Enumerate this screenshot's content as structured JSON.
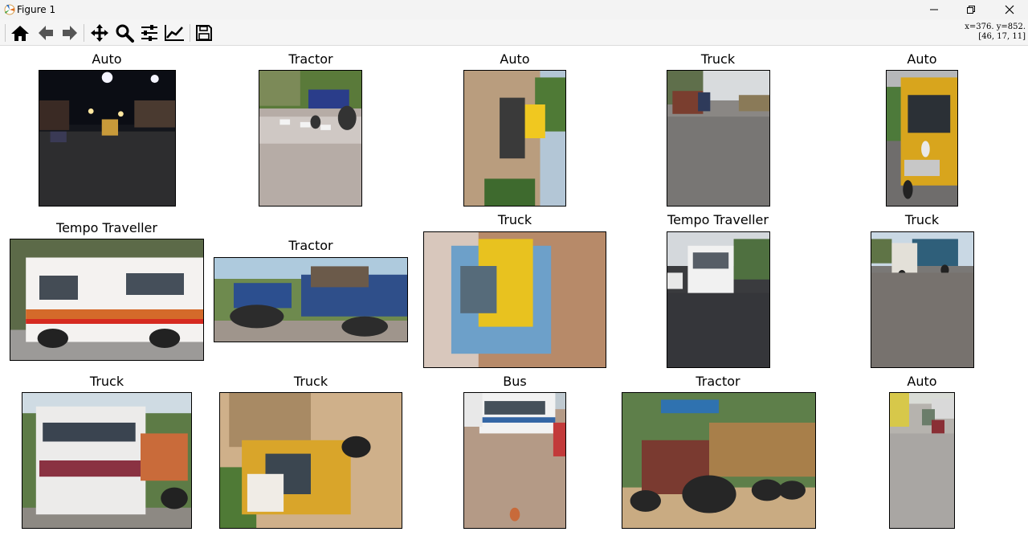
{
  "window": {
    "title": "Figure 1"
  },
  "toolbar": {
    "tools": [
      "home-icon",
      "back-icon",
      "forward-icon",
      "pan-icon",
      "zoom-icon",
      "configure-subplots-icon",
      "edit-axes-icon",
      "save-icon"
    ],
    "coords_line1": "x=376. y=852.",
    "coords_line2": "[46, 17, 11]"
  },
  "grid": {
    "row1": [
      "Auto",
      "Tractor",
      "Auto",
      "Truck",
      "Auto"
    ],
    "row2": [
      "Tempo Traveller",
      "Tractor",
      "Truck",
      "Tempo Traveller",
      "Truck"
    ],
    "row3": [
      "Truck",
      "Truck",
      "Bus",
      "Tractor",
      "Auto"
    ]
  }
}
